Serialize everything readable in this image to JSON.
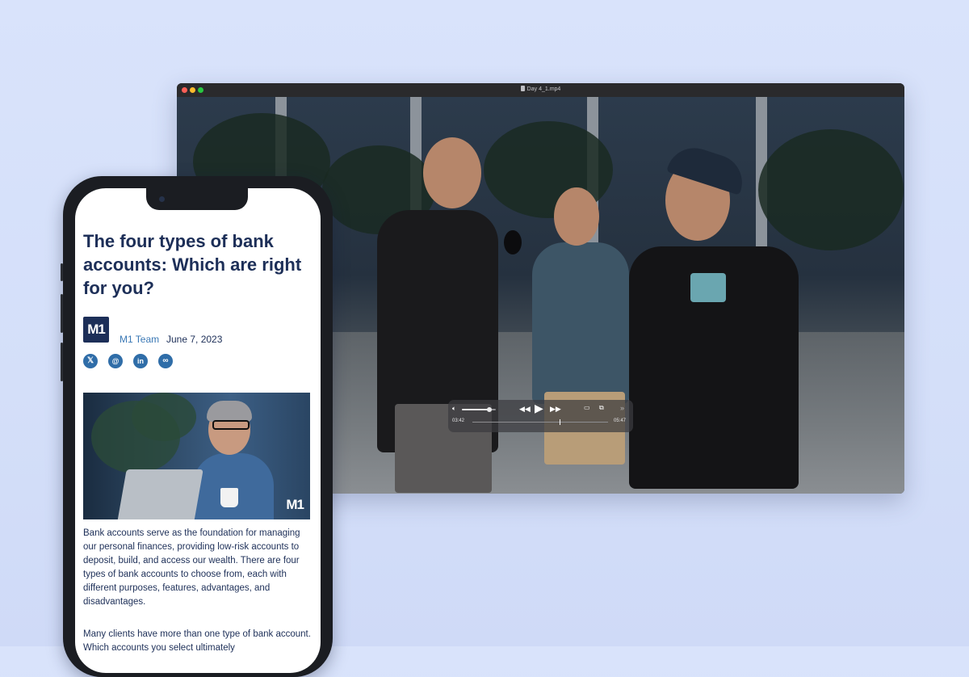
{
  "player": {
    "window_title": "Day 4_1.mp4",
    "current_time": "03:42",
    "total_time": "05:47",
    "progress": 0.64,
    "volume": 0.8,
    "colors": {
      "close": "#fe5f57",
      "minimize": "#febc2e",
      "maximize": "#28c840"
    }
  },
  "article": {
    "title": "The four types of bank accounts: Which are right for you?",
    "author_logo": "M1",
    "author": "M1 Team",
    "date": "June 7, 2023",
    "share_icons": [
      "x-icon",
      "threads-icon",
      "linkedin-icon",
      "link-icon"
    ],
    "hero_logo": "M1",
    "paragraph1": "Bank accounts serve as the foundation for managing our personal finances, providing low-risk accounts to deposit, build, and access our wealth. There are four types of bank accounts to choose from, each with different purposes, features, advantages, and disadvantages.",
    "paragraph2": "Many clients have more than one type of bank account. Which accounts you select ultimately",
    "colors": {
      "title": "#1d2f58",
      "link": "#3a78b5",
      "share": "#2f6da8"
    }
  }
}
